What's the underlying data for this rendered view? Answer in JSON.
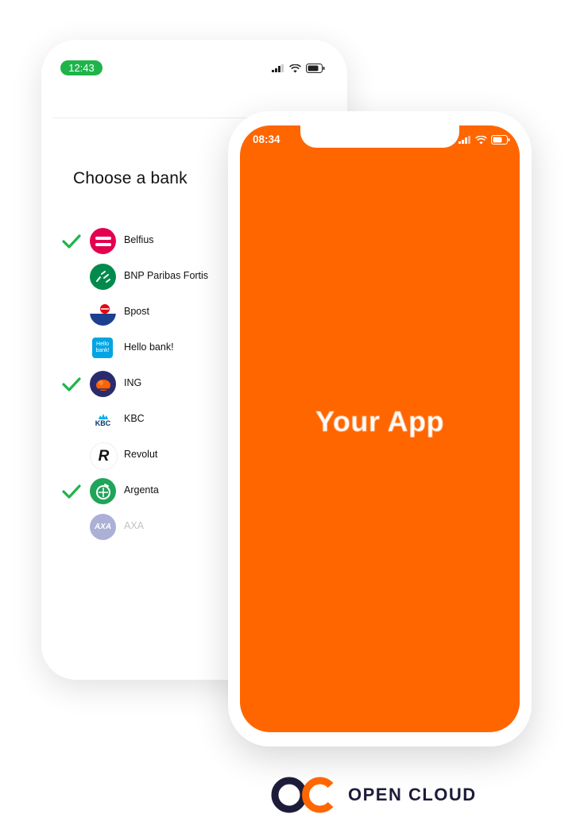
{
  "back_phone": {
    "time": "12:43",
    "title": "Choose a bank",
    "banks": [
      {
        "name": "Belfius",
        "checked": true,
        "icon": "belfius-logo"
      },
      {
        "name": "BNP Paribas Fortis",
        "checked": false,
        "icon": "bnp-logo"
      },
      {
        "name": "Bpost",
        "checked": false,
        "icon": "bpost-logo"
      },
      {
        "name": "Hello bank!",
        "checked": false,
        "icon": "hellobank-logo",
        "logo_text": "Hello bank!"
      },
      {
        "name": "ING",
        "checked": true,
        "icon": "ing-logo"
      },
      {
        "name": "KBC",
        "checked": false,
        "icon": "kbc-logo",
        "logo_text": "KBC"
      },
      {
        "name": "Revolut",
        "checked": false,
        "icon": "revolut-logo",
        "logo_text": "R"
      },
      {
        "name": "Argenta",
        "checked": true,
        "icon": "argenta-logo"
      },
      {
        "name": "AXA",
        "checked": false,
        "icon": "axa-logo",
        "logo_text": "AXA"
      }
    ]
  },
  "front_phone": {
    "time": "08:34",
    "app_title": "Your App"
  },
  "brand": {
    "logo_text": "OC",
    "name": "OPEN CLOUD"
  },
  "colors": {
    "accent": "#ff6600",
    "check_green": "#1fb44a",
    "brand_dark": "#1c1c3a"
  }
}
